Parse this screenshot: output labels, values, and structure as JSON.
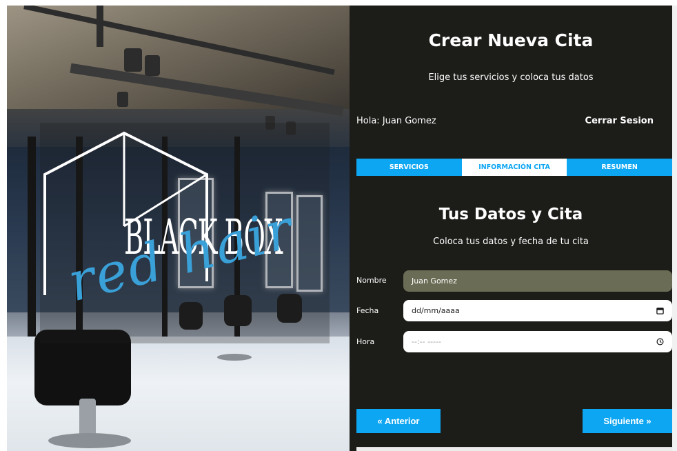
{
  "hero": {
    "logo_main": "BLACK BOX",
    "logo_script": "red hair"
  },
  "panel": {
    "title": "Crear Nueva Cita",
    "subtitle": "Elige tus servicios y coloca tus datos",
    "greeting": "Hola: Juan Gomez",
    "logout": "Cerrar Sesion",
    "tabs": [
      {
        "label": "SERVICIOS",
        "active": false
      },
      {
        "label": "INFORMACIÓN CITA",
        "active": true
      },
      {
        "label": "RESUMEN",
        "active": false
      }
    ],
    "section_title": "Tus Datos y Cita",
    "section_subtitle": "Coloca tus datos y fecha de tu cita",
    "form": {
      "name_label": "Nombre",
      "name_value": "Juan Gomez",
      "date_label": "Fecha",
      "date_placeholder": "dd/mm/aaaa",
      "time_label": "Hora",
      "time_placeholder": "--:-- -----"
    },
    "prev_button": "« Anterior",
    "next_button": "Siguiente »"
  },
  "icons": {
    "date": "calendar-icon",
    "time": "clock-icon"
  },
  "colors": {
    "accent": "#0da6f2",
    "panel_bg": "#1c1c19",
    "name_field_bg": "#6b6c55",
    "script_blue": "#3aa0d8"
  }
}
